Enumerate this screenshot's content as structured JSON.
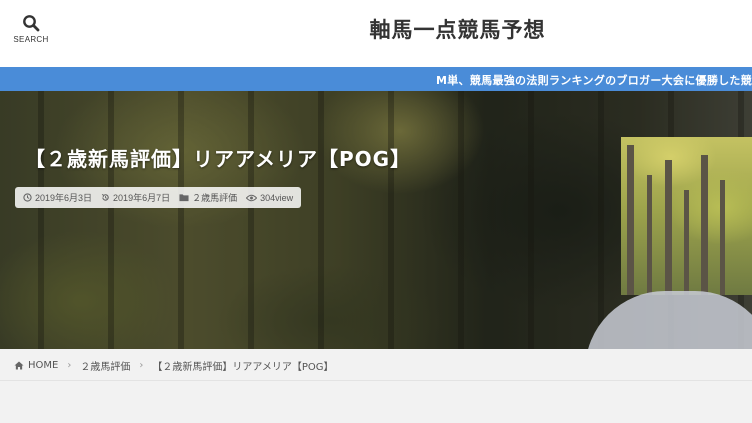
{
  "header": {
    "search_label": "SEARCH",
    "site_title": "軸馬一点競馬予想"
  },
  "ticker": {
    "text": "M単、競馬最強の法則ランキングのブロガー大会に優勝した競馬予"
  },
  "hero": {
    "title": "【２歳新馬評価】リアアメリア【POG】",
    "meta": {
      "published": "2019年6月3日",
      "updated": "2019年6月7日",
      "category": "２歳馬評価",
      "views": "304view"
    }
  },
  "breadcrumb": {
    "home": "HOME",
    "category": "２歳馬評価",
    "current": "【２歳新馬評価】リアアメリア【POG】",
    "separator": "›"
  },
  "colors": {
    "ticker_bg": "#4a8cd8",
    "header_bg": "#ffffff",
    "page_bg": "#f2f2f2"
  },
  "icons": [
    "search-icon",
    "clock-icon",
    "history-icon",
    "folder-icon",
    "eye-icon",
    "home-icon"
  ]
}
